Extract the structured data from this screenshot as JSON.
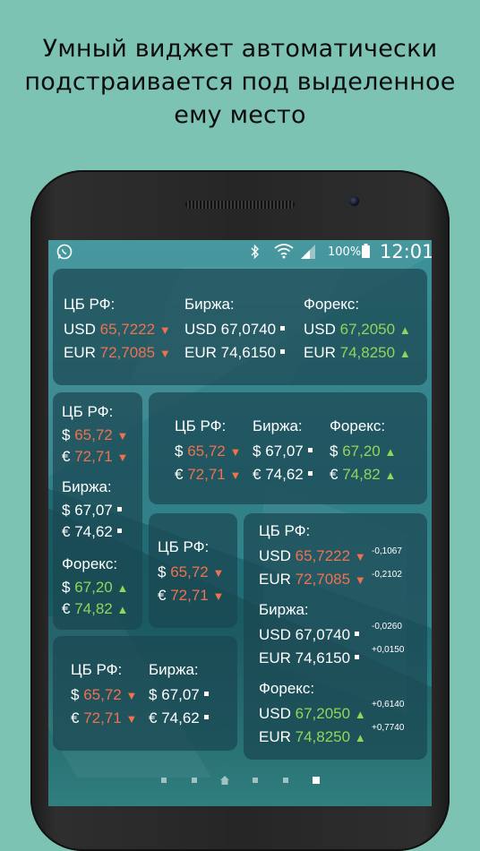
{
  "headline": {
    "line1": "Умный виджет автоматически",
    "line2": "подстраивается под выделенное",
    "line3": "ему место"
  },
  "status": {
    "app_icon": "whatsapp-icon",
    "battery": "100%",
    "time": "12:01"
  },
  "labels": {
    "cb": "ЦБ РФ:",
    "birzha": "Биржа:",
    "forex": "Форекс:",
    "usd": "USD",
    "eur": "EUR",
    "usd_sym": "$",
    "eur_sym": "€"
  },
  "rates_full": {
    "cb_usd": "65,7222",
    "cb_eur": "72,7085",
    "birzha_usd": "67,0740",
    "birzha_eur": "74,6150",
    "forex_usd": "67,2050",
    "forex_eur": "74,8250"
  },
  "rates_short": {
    "cb_usd": "65,72",
    "cb_eur": "72,71",
    "birzha_usd": "67,07",
    "birzha_eur": "74,62",
    "forex_usd": "67,20",
    "forex_eur": "74,82"
  },
  "deltas": {
    "cb_usd": "-0,1067",
    "cb_eur": "-0,2102",
    "birzha_usd": "-0,0260",
    "birzha_eur": "+0,0150",
    "forex_usd": "+0,6140",
    "forex_eur": "+0,7740"
  },
  "arrows": {
    "down": "▼",
    "up": "▲"
  },
  "colors": {
    "down": "#f0714e",
    "up": "#93d45a",
    "background": "#7cc3b4"
  },
  "pager": {
    "active_index": 5,
    "count": 6
  }
}
